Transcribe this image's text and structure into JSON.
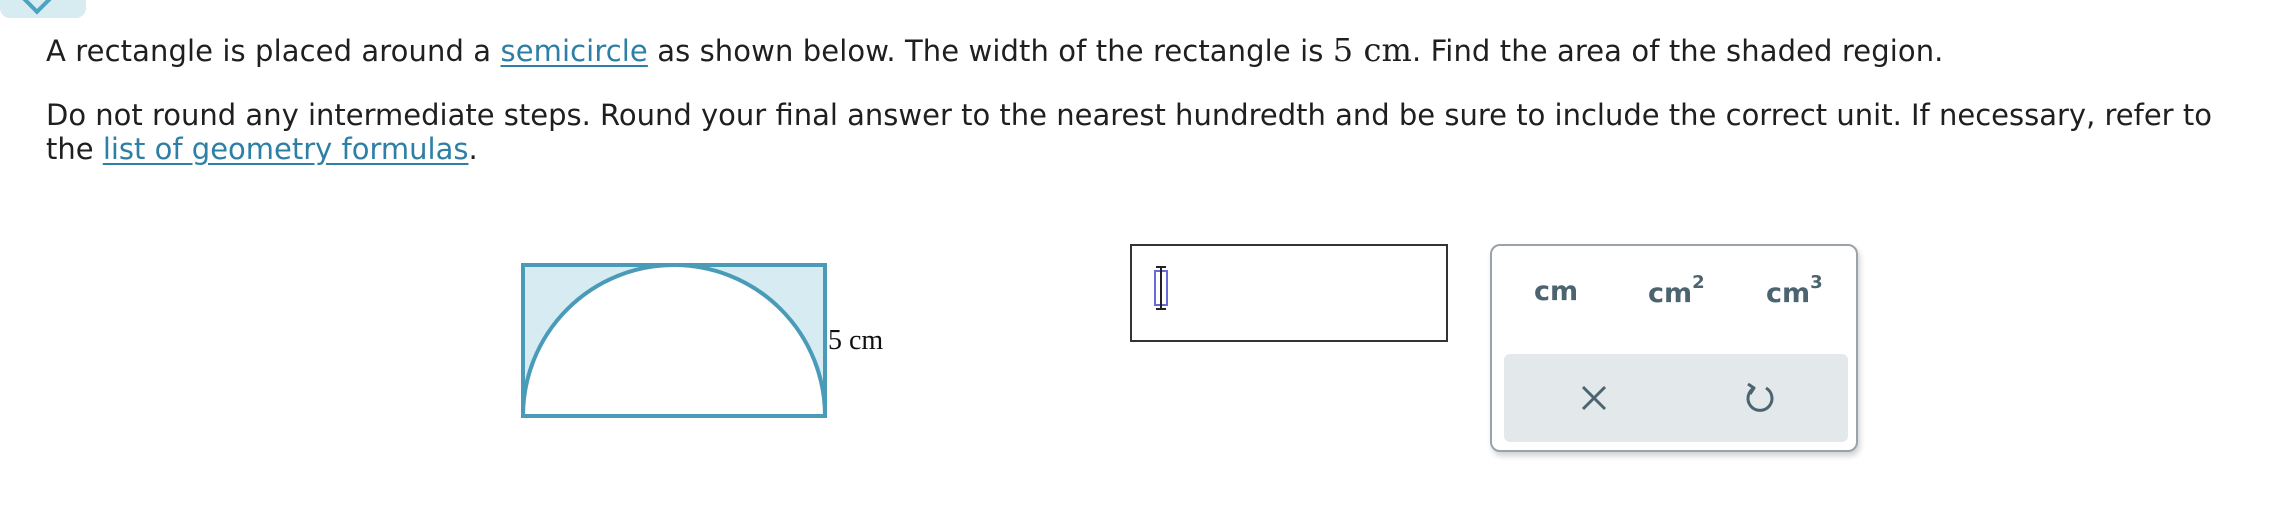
{
  "prompt": {
    "part1": "A rectangle is placed around a ",
    "link_text": "semicircle",
    "part2": " as shown below. The width of the rectangle is ",
    "width_value": "5 cm",
    "part3": ". Find the area of the shaded region."
  },
  "instructions": {
    "text": "Do not round any intermediate steps. Round your final answer to the nearest hundredth and be sure to include the correct unit. If necessary, refer to the ",
    "link_text": "list of geometry formulas",
    "end": "."
  },
  "figure": {
    "dimension_label": "5 cm",
    "shade_color": "#d6ecf2",
    "stroke_color": "#4a9bb8"
  },
  "answer": {
    "value": ""
  },
  "units": {
    "options": [
      {
        "base": "cm",
        "sup": ""
      },
      {
        "base": "cm",
        "sup": "2"
      },
      {
        "base": "cm",
        "sup": "3"
      }
    ],
    "clear_icon": "x-icon",
    "undo_icon": "undo-icon"
  },
  "colors": {
    "link": "#2d7fa6",
    "unit_text": "#4b6470",
    "action_bar": "#e3e8ea"
  }
}
